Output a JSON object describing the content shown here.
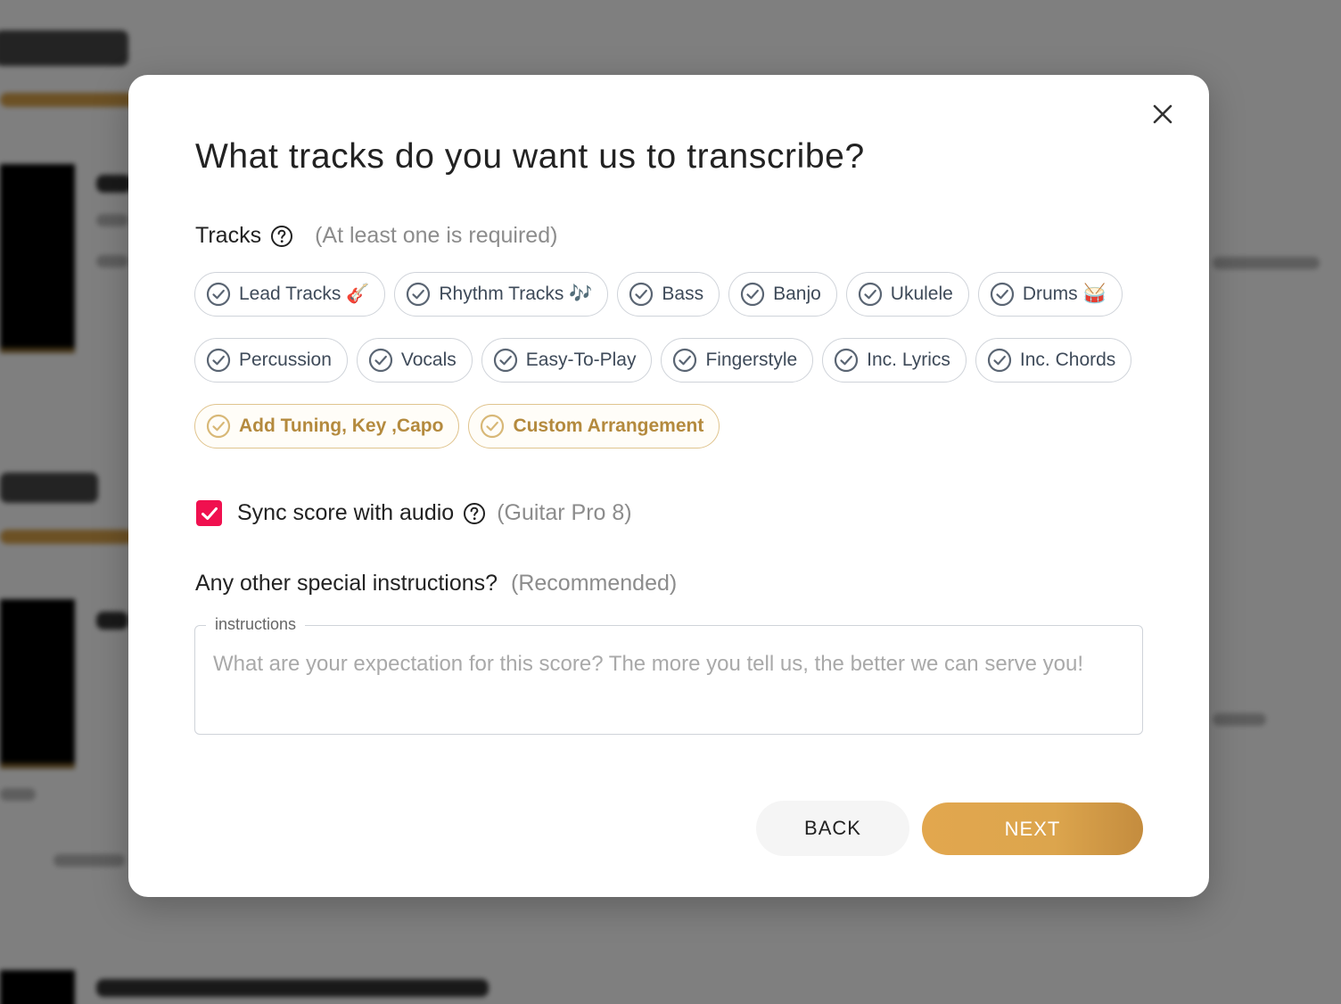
{
  "modal": {
    "title": "What tracks do you want us to transcribe?",
    "tracks_label": "Tracks",
    "tracks_hint": "(At least one is required)",
    "chip_rows": [
      [
        {
          "label": "Lead Tracks 🎸",
          "name": "chip-lead-tracks"
        },
        {
          "label": "Rhythm Tracks 🎶",
          "name": "chip-rhythm-tracks"
        },
        {
          "label": "Bass",
          "name": "chip-bass"
        },
        {
          "label": "Banjo",
          "name": "chip-banjo"
        },
        {
          "label": "Ukulele",
          "name": "chip-ukulele"
        },
        {
          "label": "Drums 🥁",
          "name": "chip-drums"
        }
      ],
      [
        {
          "label": "Percussion",
          "name": "chip-percussion"
        },
        {
          "label": "Vocals",
          "name": "chip-vocals"
        },
        {
          "label": "Easy-To-Play",
          "name": "chip-easy-to-play"
        },
        {
          "label": "Fingerstyle",
          "name": "chip-fingerstyle"
        },
        {
          "label": "Inc. Lyrics",
          "name": "chip-inc-lyrics"
        },
        {
          "label": "Inc. Chords",
          "name": "chip-inc-chords"
        }
      ],
      [
        {
          "label": "Add Tuning, Key ,Capo",
          "name": "chip-add-tuning-key-capo",
          "style": "gold"
        },
        {
          "label": "Custom Arrangement",
          "name": "chip-custom-arrangement",
          "style": "gold"
        }
      ]
    ],
    "sync": {
      "checked": true,
      "label": "Sync score with audio",
      "hint": "(Guitar Pro 8)"
    },
    "special": {
      "label": "Any other special instructions?",
      "hint": "(Recommended)"
    },
    "instructions": {
      "legend": "instructions",
      "value": "",
      "placeholder": "What are your expectation for this score? The more you tell us, the better we can serve you!"
    },
    "back_label": "BACK",
    "next_label": "NEXT"
  },
  "colors": {
    "accent_gold": "#DCA54D",
    "checkbox_pink": "#F0104F",
    "chip_border": "#CFD3D9",
    "chip_text": "#3E4A59",
    "gold_chip_text": "#B48A3E"
  },
  "icons": {
    "close": "close-icon",
    "help": "question-circle-icon",
    "chip_check": "check-circle-icon",
    "checkbox": "checkmark-icon"
  }
}
